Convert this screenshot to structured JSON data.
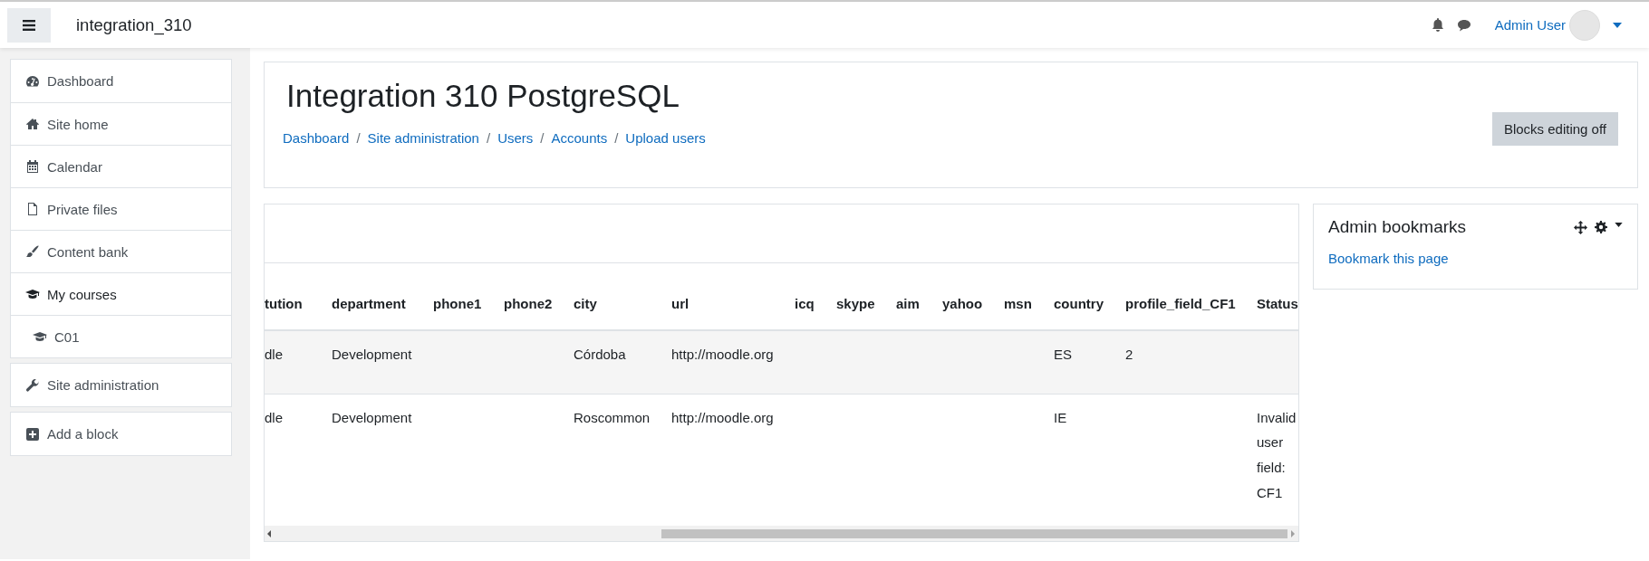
{
  "header": {
    "site_name": "integration_310",
    "user_name": "Admin User"
  },
  "nav": [
    {
      "items": [
        {
          "label": "Dashboard"
        },
        {
          "label": "Site home"
        },
        {
          "label": "Calendar"
        },
        {
          "label": "Private files"
        },
        {
          "label": "Content bank"
        },
        {
          "label": "My courses",
          "children": [
            {
              "label": "C01"
            }
          ]
        }
      ]
    },
    {
      "items": [
        {
          "label": "Site administration"
        }
      ]
    },
    {
      "items": [
        {
          "label": "Add a block"
        }
      ]
    }
  ],
  "page": {
    "title": "Integration 310 PostgreSQL",
    "breadcrumb": [
      {
        "kind": "link",
        "text": "Dashboard"
      },
      {
        "kind": "separator",
        "text": "/"
      },
      {
        "kind": "link",
        "text": "Site administration"
      },
      {
        "kind": "separator",
        "text": "/"
      },
      {
        "kind": "link",
        "text": "Users"
      },
      {
        "kind": "separator",
        "text": "/"
      },
      {
        "kind": "link",
        "text": "Accounts"
      },
      {
        "kind": "separator",
        "text": "/"
      },
      {
        "kind": "link",
        "text": "Upload users"
      }
    ],
    "editing_button": "Blocks editing off"
  },
  "table": {
    "columns": [
      "tution",
      "department",
      "phone1",
      "phone2",
      "city",
      "url",
      "icq",
      "skype",
      "aim",
      "yahoo",
      "msn",
      "country",
      "profile_field_CF1",
      "Status"
    ],
    "rows": [
      {
        "cells": [
          "dle",
          "Development",
          "",
          "",
          "Córdoba",
          "http://moodle.org",
          "",
          "",
          "",
          "",
          "",
          "ES",
          "2",
          ""
        ]
      },
      {
        "cells": [
          "dle",
          "Development",
          "",
          "",
          "Roscommon",
          "http://moodle.org",
          "",
          "",
          "",
          "",
          "",
          "IE",
          "",
          "Invalid user field: CF1"
        ]
      }
    ]
  },
  "block": {
    "title": "Admin bookmarks",
    "link": "Bookmark this page"
  }
}
